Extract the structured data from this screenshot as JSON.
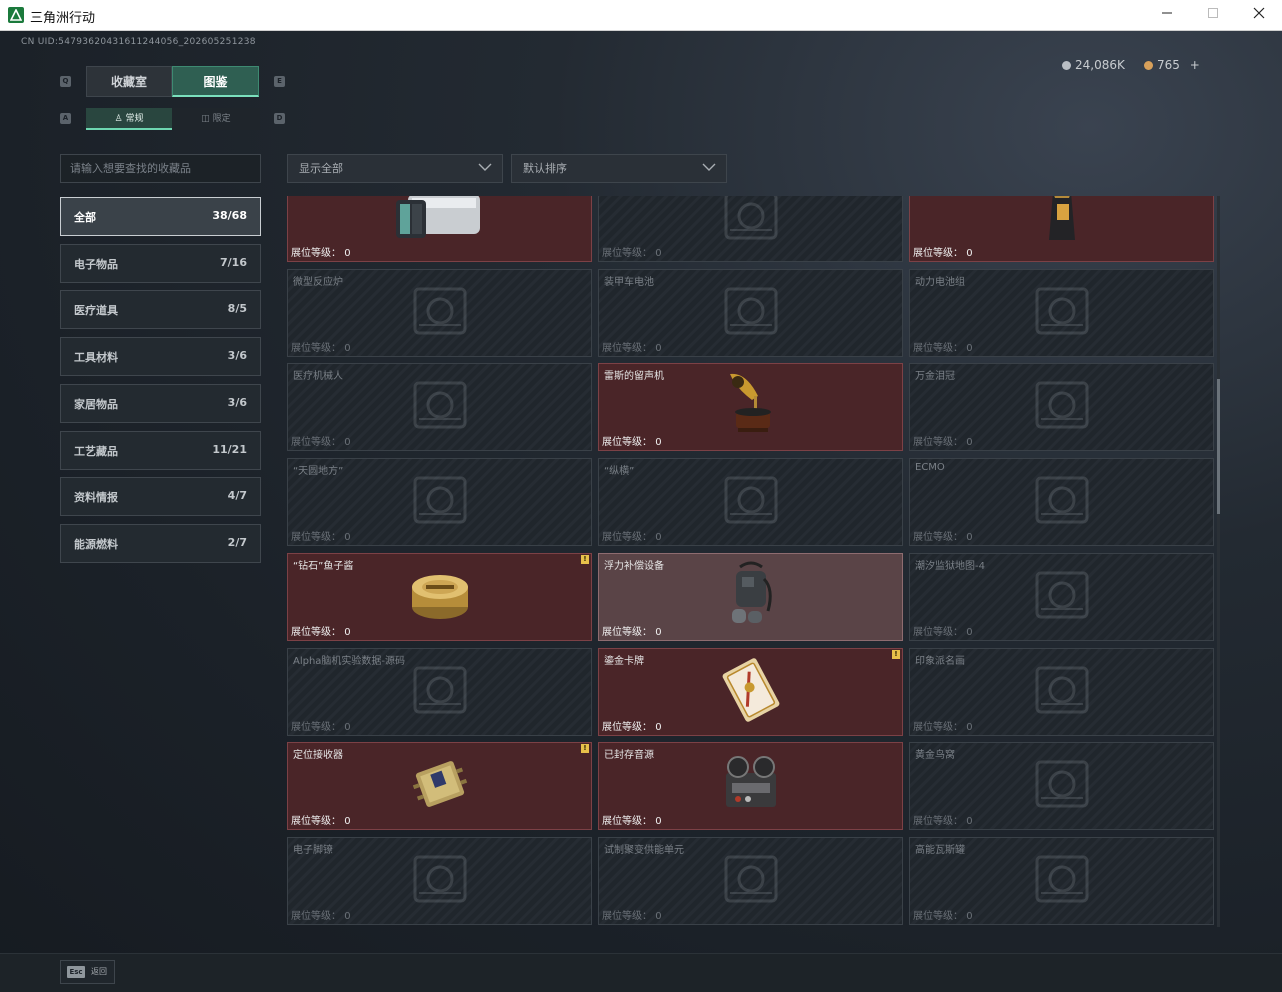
{
  "window": {
    "title": "三角洲行动",
    "min_icon": "minimize-icon",
    "max_icon": "maximize-icon",
    "close_icon": "close-icon"
  },
  "header": {
    "uid": "CN UID:5479362043161124405​6_202605251238",
    "currency1": "24,086K",
    "currency2": "765",
    "plus": "+"
  },
  "tabs": {
    "left_key": "Q",
    "right_key": "E",
    "collection": "收藏室",
    "gallery": "图鉴"
  },
  "subtabs": {
    "left_key": "A",
    "right_key": "D",
    "normal": "常规",
    "limited": "限定"
  },
  "search": {
    "placeholder": "请输入想要查找的收藏品"
  },
  "filters": {
    "show": "显示全部",
    "sort": "默认排序"
  },
  "categories": [
    {
      "label": "全部",
      "count": "38/68"
    },
    {
      "label": "电子物品",
      "count": "7/16"
    },
    {
      "label": "医疗道具",
      "count": "8/5"
    },
    {
      "label": "工具材料",
      "count": "3/6"
    },
    {
      "label": "家居物品",
      "count": "3/6"
    },
    {
      "label": "工艺藏品",
      "count": "11/21"
    },
    {
      "label": "资料情报",
      "count": "4/7"
    },
    {
      "label": "能源燃料",
      "count": "2/7"
    }
  ],
  "level_label": "展位等级：",
  "items": [
    {
      "name": "",
      "level": "0",
      "owned": true,
      "icon": "camera-device-icon"
    },
    {
      "name": "",
      "level": "0",
      "owned": false,
      "icon": "machine-icon"
    },
    {
      "name": "",
      "level": "0",
      "owned": true,
      "icon": "coffee-bag-icon"
    },
    {
      "name": "微型反应炉",
      "level": "0",
      "owned": false,
      "icon": "reactor-icon"
    },
    {
      "name": "装甲车电池",
      "level": "0",
      "owned": false,
      "icon": "battery-icon"
    },
    {
      "name": "动力电池组",
      "level": "0",
      "owned": false,
      "icon": "battery-pack-icon"
    },
    {
      "name": "医疗机械人",
      "level": "0",
      "owned": false,
      "icon": "medical-robot-icon"
    },
    {
      "name": "雷斯的留声机",
      "level": "0",
      "owned": true,
      "icon": "gramophone-icon"
    },
    {
      "name": "万金泪冠",
      "level": "0",
      "owned": false,
      "icon": "crown-icon"
    },
    {
      "name": "“天圆地方”",
      "level": "0",
      "owned": false,
      "icon": "globe-icon"
    },
    {
      "name": "“纵横”",
      "level": "0",
      "owned": false,
      "icon": "chess-icon"
    },
    {
      "name": "ECMO",
      "level": "0",
      "owned": false,
      "icon": "ecmo-icon"
    },
    {
      "name": "“钻石”鱼子酱",
      "level": "0",
      "owned": true,
      "icon": "caviar-icon",
      "badge": "!"
    },
    {
      "name": "浮力补偿设备",
      "level": "0",
      "owned": true,
      "highlight": true,
      "icon": "buoyancy-device-icon"
    },
    {
      "name": "潮汐监狱地图-4",
      "level": "0",
      "owned": false,
      "icon": "map-icon"
    },
    {
      "name": "Alpha脑机实验数据-源码",
      "level": "0",
      "owned": false,
      "icon": "data-icon"
    },
    {
      "name": "鎏金卡牌",
      "level": "0",
      "owned": true,
      "icon": "gold-card-icon",
      "badge": "!"
    },
    {
      "name": "印象派名画",
      "level": "0",
      "owned": false,
      "icon": "painting-icon"
    },
    {
      "name": "定位接收器",
      "level": "0",
      "owned": true,
      "icon": "receiver-icon",
      "badge": "!"
    },
    {
      "name": "已封存音源",
      "level": "0",
      "owned": true,
      "icon": "tape-recorder-icon"
    },
    {
      "name": "黄金鸟窝",
      "level": "0",
      "owned": false,
      "icon": "nest-icon"
    },
    {
      "name": "电子脚镣",
      "level": "0",
      "owned": false,
      "icon": "shackle-icon"
    },
    {
      "name": "试制聚变供能单元",
      "level": "0",
      "owned": false,
      "icon": "fusion-unit-icon"
    },
    {
      "name": "高能瓦斯罐",
      "level": "0",
      "owned": false,
      "icon": "gas-tank-icon"
    }
  ],
  "footer": {
    "esc_key": "Esc",
    "esc_label": "返回"
  },
  "colors": {
    "owned_bg": "#4a2528",
    "accent": "#6ed7b1",
    "badge": "#e8c14a"
  }
}
